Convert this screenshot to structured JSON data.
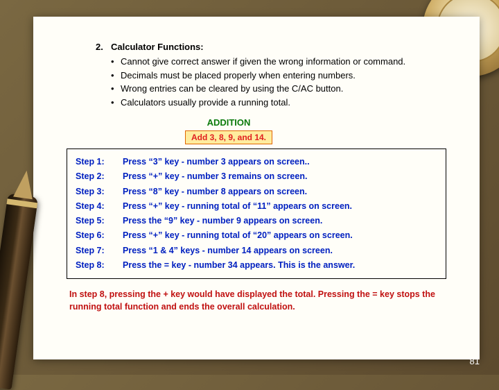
{
  "heading": {
    "number": "2.",
    "title": "Calculator Functions:"
  },
  "bullets": [
    "Cannot give correct answer if given the wrong information or command.",
    "Decimals must be placed properly when entering numbers.",
    "Wrong entries can be cleared by using the C/AC button.",
    "Calculators usually provide a running total."
  ],
  "section_title": "ADDITION",
  "example_prompt": "Add 3, 8, 9, and 14.",
  "steps": [
    {
      "label": "Step 1:",
      "text": "Press “3” key - number 3 appears on screen.."
    },
    {
      "label": "Step 2:",
      "text": "Press “+” key - number 3 remains on screen."
    },
    {
      "label": "Step 3:",
      "text": "Press “8” key - number 8 appears on screen."
    },
    {
      "label": "Step 4:",
      "text": "Press “+” key - running total of “11” appears on screen."
    },
    {
      "label": "Step 5:",
      "text": "Press the “9” key - number 9 appears on screen."
    },
    {
      "label": "Step 6:",
      "text": "Press “+” key - running total of “20” appears on screen."
    },
    {
      "label": "Step 7:",
      "text": "Press “1 & 4” keys - number 14 appears on screen."
    },
    {
      "label": "Step 8:",
      "text": "Press the = key - number 34 appears. This is the answer."
    }
  ],
  "footer_note": "In step 8, pressing the + key would have displayed the total. Pressing the = key stops the running total function and ends the overall calculation.",
  "page_number": "81"
}
